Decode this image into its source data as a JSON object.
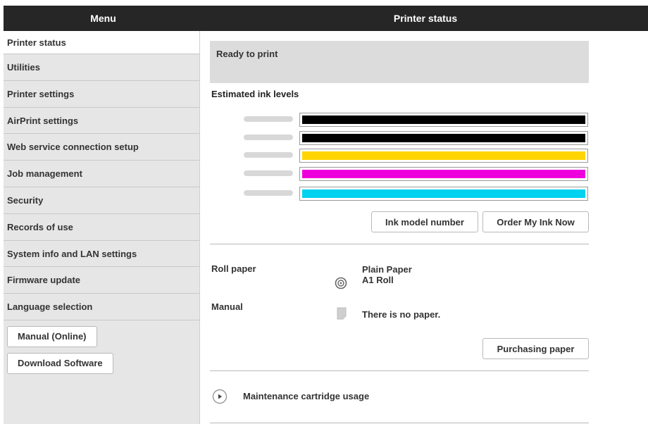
{
  "header": {
    "menu_title": "Menu",
    "page_title": "Printer status"
  },
  "sidebar": {
    "items": [
      {
        "label": "Printer status"
      },
      {
        "label": "Utilities"
      },
      {
        "label": "Printer settings"
      },
      {
        "label": "AirPrint settings"
      },
      {
        "label": "Web service connection setup"
      },
      {
        "label": "Job management"
      },
      {
        "label": "Security"
      },
      {
        "label": "Records of use"
      },
      {
        "label": "System info and LAN settings"
      },
      {
        "label": "Firmware update"
      },
      {
        "label": "Language selection"
      }
    ],
    "manual_button": "Manual (Online)",
    "download_button": "Download Software"
  },
  "main": {
    "status_text": "Ready to print",
    "ink_title": "Estimated ink levels",
    "inks": [
      {
        "color": "#000000",
        "level_percent": 100
      },
      {
        "color": "#000000",
        "level_percent": 100
      },
      {
        "color": "#ffd400",
        "level_percent": 100
      },
      {
        "color": "#ee00dd",
        "level_percent": 100
      },
      {
        "color": "#00d2f0",
        "level_percent": 100
      }
    ],
    "ink_model_button": "Ink model number",
    "order_ink_button": "Order My Ink Now",
    "roll_paper_label": "Roll paper",
    "roll_paper_type": "Plain Paper",
    "roll_paper_size": "A1 Roll",
    "manual_label": "Manual",
    "manual_status": "There is no paper.",
    "purchase_paper_button": "Purchasing paper",
    "maintenance_label": "Maintenance cartridge usage"
  }
}
